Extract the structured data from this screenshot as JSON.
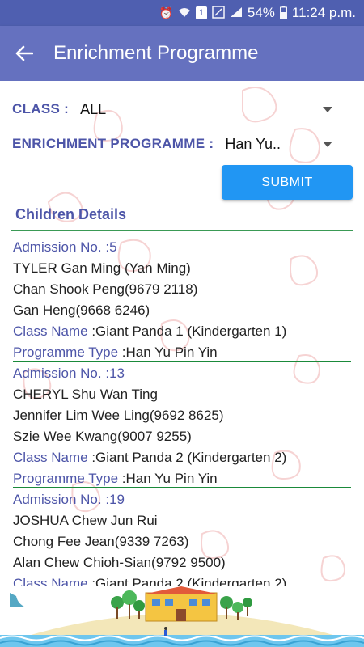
{
  "status_bar": {
    "battery": "54%",
    "time": "11:24 p.m.",
    "sim_label": "1"
  },
  "app_bar": {
    "title": "Enrichment Programme"
  },
  "filters": {
    "class_label": "CLASS :",
    "class_value": "ALL",
    "programme_label": "ENRICHMENT PROGRAMME :",
    "programme_value": "Han Yu.."
  },
  "submit_label": "SUBMIT",
  "section_title": "Children Details",
  "labels": {
    "admission": "Admission No.",
    "class_name": "Class Name",
    "programme_type": "Programme Type"
  },
  "children": [
    {
      "admission_no": ":5",
      "child_name": "TYLER Gan Ming (Yan Ming)",
      "guardian1": "Chan Shook Peng(9679 2118)",
      "guardian2": "Gan Heng(9668 6246)",
      "class_name": "Giant Panda 1 (Kindergarten 1)",
      "programme_type": "Han Yu Pin Yin"
    },
    {
      "admission_no": ":13",
      "child_name": "CHERYL Shu Wan Ting",
      "guardian1": "Jennifer Lim Wee Ling(9692 8625)",
      "guardian2": "Szie Wee Kwang(9007 9255)",
      "class_name": "Giant Panda 2 (Kindergarten 2)",
      "programme_type": "Han Yu Pin Yin"
    },
    {
      "admission_no": ":19",
      "child_name": "JOSHUA Chew Jun Rui",
      "guardian1": "Chong Fee Jean(9339 7263)",
      "guardian2": "Alan Chew Chioh-Sian(9792 9500)",
      "class_name": "Giant Panda 2 (Kindergarten 2)",
      "programme_type": ""
    }
  ],
  "colors": {
    "status_bar": "#4f5fb0",
    "app_bar": "#6571bf",
    "label_blue": "#4d55a8",
    "submit_blue": "#2196f3",
    "divider_green": "#1a8a3a"
  }
}
